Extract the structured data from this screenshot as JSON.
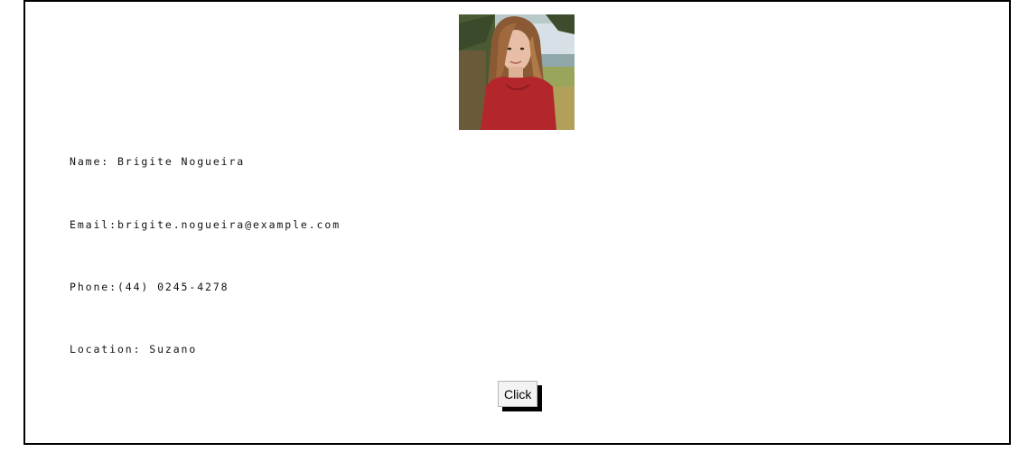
{
  "profile": {
    "photo_alt": "",
    "name_label": "Name: ",
    "name": "Brigite Nogueira",
    "email_label": "Email:",
    "email": "brigite.nogueira@example.com",
    "phone_label": "Phone:",
    "phone": "(44) 0245-4278",
    "location_label": "Location: ",
    "location": "Suzano"
  },
  "actions": {
    "click_label": "Click"
  },
  "colors": {
    "border": "#000000",
    "text": "#111111",
    "button_shadow": "#000000"
  }
}
